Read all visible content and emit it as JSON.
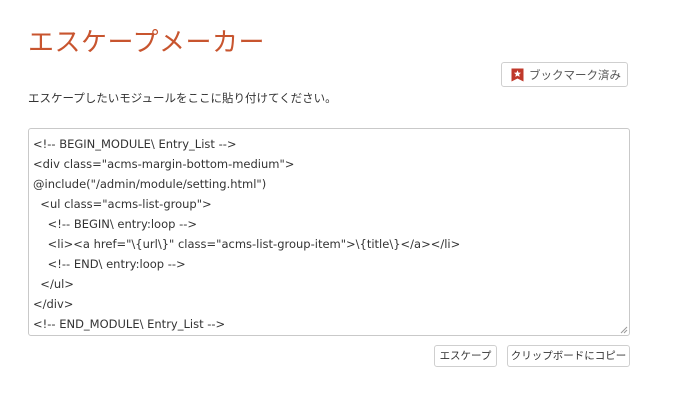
{
  "header": {
    "title": "エスケープメーカー"
  },
  "toolbar": {
    "bookmark_label": "ブックマーク済み",
    "bookmark_icon": "bookmark-star-icon",
    "bookmark_icon_color": "#c0392b"
  },
  "main": {
    "instructions": "エスケープしたいモジュールをここに貼り付けてください。",
    "code_lines": [
      "<!-- BEGIN_MODULE\\ Entry_List -->",
      "<div class=\"acms-margin-bottom-medium\">",
      "@include(\"/admin/module/setting.html\")",
      "  <ul class=\"acms-list-group\">",
      "    <!-- BEGIN\\ entry:loop -->",
      "    <li><a href=\"\\{url\\}\" class=\"acms-list-group-item\">\\{title\\}</a></li>",
      "    <!-- END\\ entry:loop -->",
      "  </ul>",
      "</div>",
      "<!-- END_MODULE\\ Entry_List -->"
    ]
  },
  "actions": {
    "escape_label": "エスケープ",
    "copy_label": "クリップボードにコピー"
  },
  "colors": {
    "title": "#c8552f",
    "border": "#cfcfcf"
  }
}
